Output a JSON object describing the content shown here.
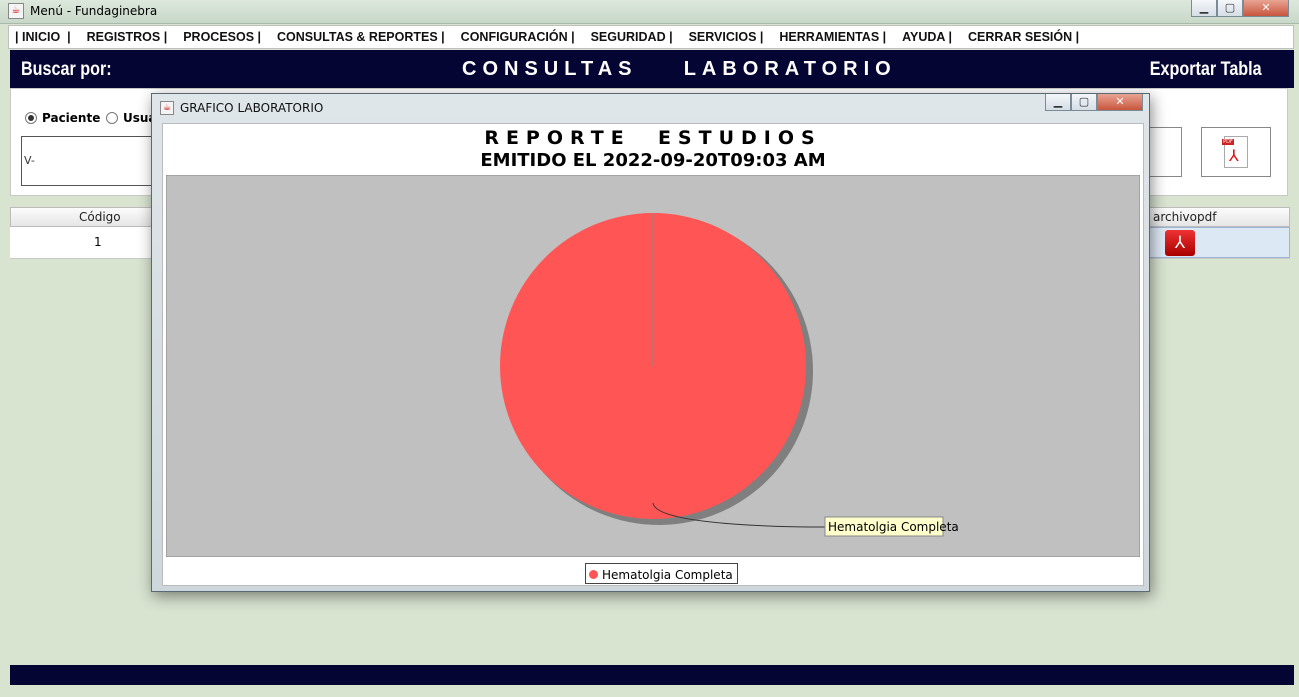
{
  "window": {
    "title": "Menú - Fundaginebra"
  },
  "menu": [
    "| INICIO  |",
    "REGISTROS |",
    "PROCESOS |",
    "CONSULTAS & REPORTES |",
    "CONFIGURACIÓN |",
    "SEGURIDAD |",
    "SERVICIOS |",
    "HERRAMIENTAS |",
    "AYUDA |",
    "CERRAR SESIÓN |"
  ],
  "header": {
    "search_label": "Buscar por:",
    "title": "CONSULTAS    LABORATORIO",
    "export_label": "Exportar Tabla"
  },
  "search": {
    "radio_paciente": "Paciente",
    "radio_usuario": "Usua",
    "input_value": "V-"
  },
  "table": {
    "columns": [
      "Código",
      "archivopdf"
    ],
    "rows": [
      {
        "codigo": "1"
      }
    ]
  },
  "dialog": {
    "title": "GRAFICO LABORATORIO",
    "chart_title": "REPORTE  ESTUDIOS",
    "chart_subtitle": "EMITIDO EL 2022-09-20T09:03 AM",
    "slice_label": "Hematolgia Completa"
  },
  "colors": {
    "navy": "#050533",
    "slice": "#ff5555",
    "plot_bg": "#c0c0c0"
  },
  "chart_data": {
    "type": "pie",
    "title": "REPORTE  ESTUDIOS",
    "subtitle": "EMITIDO EL 2022-09-20T09:03 AM",
    "categories": [
      "Hematolgia Completa"
    ],
    "values": [
      100
    ],
    "unit": "%",
    "legend": "bottom"
  }
}
